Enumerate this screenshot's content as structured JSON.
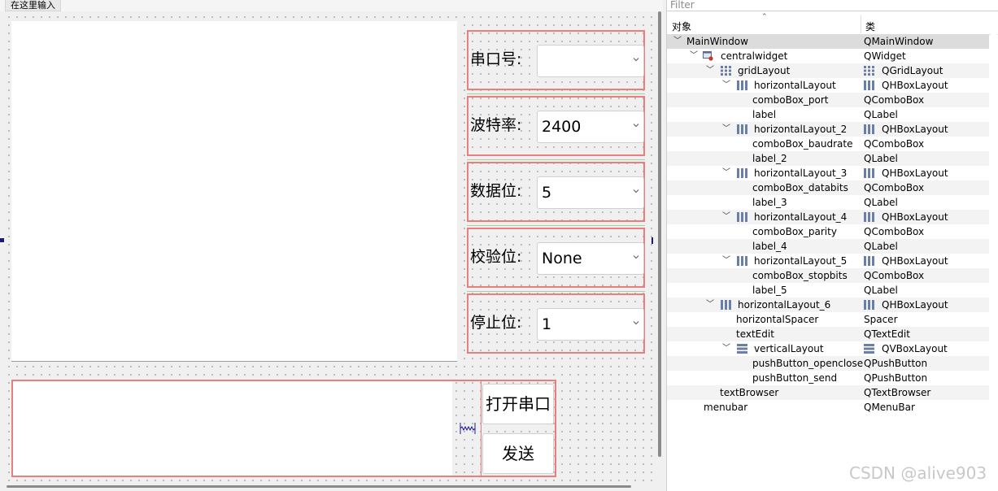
{
  "form": {
    "menu_input_placeholder": "在这里输入",
    "layouts": [
      {
        "label": "串口号:",
        "value": ""
      },
      {
        "label": "波特率:",
        "value": "2400"
      },
      {
        "label": "数据位:",
        "value": "5"
      },
      {
        "label": "校验位:",
        "value": "None"
      },
      {
        "label": "停止位:",
        "value": "1"
      }
    ],
    "buttons": {
      "open": "打开串口",
      "send": "发送"
    }
  },
  "inspector": {
    "filter_placeholder": "Filter",
    "col_object": "对象",
    "col_class": "类",
    "rows": [
      {
        "name": "MainWindow",
        "class": "QMainWindow"
      },
      {
        "name": "centralwidget",
        "class": "QWidget"
      },
      {
        "name": "gridLayout",
        "class": "QGridLayout"
      },
      {
        "name": "horizontalLayout",
        "class": "QHBoxLayout"
      },
      {
        "name": "comboBox_port",
        "class": "QComboBox"
      },
      {
        "name": "label",
        "class": "QLabel"
      },
      {
        "name": "horizontalLayout_2",
        "class": "QHBoxLayout"
      },
      {
        "name": "comboBox_baudrate",
        "class": "QComboBox"
      },
      {
        "name": "label_2",
        "class": "QLabel"
      },
      {
        "name": "horizontalLayout_3",
        "class": "QHBoxLayout"
      },
      {
        "name": "comboBox_databits",
        "class": "QComboBox"
      },
      {
        "name": "label_3",
        "class": "QLabel"
      },
      {
        "name": "horizontalLayout_4",
        "class": "QHBoxLayout"
      },
      {
        "name": "comboBox_parity",
        "class": "QComboBox"
      },
      {
        "name": "label_4",
        "class": "QLabel"
      },
      {
        "name": "horizontalLayout_5",
        "class": "QHBoxLayout"
      },
      {
        "name": "comboBox_stopbits",
        "class": "QComboBox"
      },
      {
        "name": "label_5",
        "class": "QLabel"
      },
      {
        "name": "horizontalLayout_6",
        "class": "QHBoxLayout"
      },
      {
        "name": "horizontalSpacer",
        "class": "Spacer"
      },
      {
        "name": "textEdit",
        "class": "QTextEdit"
      },
      {
        "name": "verticalLayout",
        "class": "QVBoxLayout"
      },
      {
        "name": "pushButton_openclose",
        "class": "QPushButton"
      },
      {
        "name": "pushButton_send",
        "class": "QPushButton"
      },
      {
        "name": "textBrowser",
        "class": "QTextBrowser"
      },
      {
        "name": "menubar",
        "class": "QMenuBar"
      }
    ]
  },
  "watermark": "CSDN @alive903"
}
